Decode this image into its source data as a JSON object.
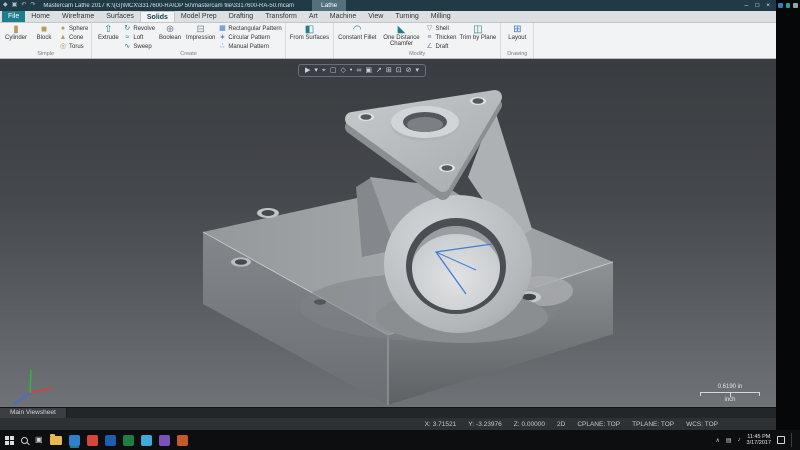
{
  "colors": {
    "accent": "#1d7f8e",
    "sketch": "#3f7fd6",
    "axis-x": "#e03c3c",
    "axis-y": "#35b53a",
    "axis-z": "#3a6fe0"
  },
  "icons": {
    "app-icon": "◆",
    "save-icon": "▣",
    "undo-icon": "↶",
    "redo-icon": "↷",
    "minimize-icon": "–",
    "maximize-icon": "□",
    "close-icon": "×",
    "cylinder-icon": "▮",
    "block-icon": "■",
    "sphere-icon": "●",
    "cone-icon": "▲",
    "torus-icon": "◎",
    "extrude-icon": "⇧",
    "revolve-icon": "↻",
    "loft-icon": "≈",
    "sweep-icon": "∿",
    "boolean-icon": "⊕",
    "impression-icon": "⊟",
    "rect-pattern-icon": "▦",
    "circ-pattern-icon": "∗",
    "manual-pattern-icon": "∴",
    "from-surfaces-icon": "◧",
    "fillet-icon": "◠",
    "chamfer-icon": "◣",
    "shell-icon": "▽",
    "thicken-icon": "≡",
    "draft-icon": "∠",
    "trim-plane-icon": "◫",
    "layout-icon": "⊞",
    "select-cursor-icon": "▶",
    "dropdown-icon": "▾",
    "crosshair-icon": "⌖",
    "window-select-icon": "▢",
    "polygon-select-icon": "◇",
    "single-select-icon": "•",
    "chain-select-icon": "∞",
    "area-select-icon": "▣",
    "vector-select-icon": "↗",
    "all-select-icon": "⊞",
    "only-select-icon": "⊡",
    "clear-select-icon": "⊘",
    "taskview-icon": "▣",
    "tray-chevron-icon": "∧",
    "tray-display-icon": "▤",
    "tray-volume-icon": "♪"
  },
  "window": {
    "title": "Mastercam Lathe 2017    K:\\(G)\\MCX\\3317600-RA\\OP 50\\mastercam file\\3317600-RA-50.mcam",
    "context_tab": "Lathe"
  },
  "ribbon": {
    "tabs": [
      "File",
      "Home",
      "Wireframe",
      "Surfaces",
      "Solids",
      "Model Prep",
      "Drafting",
      "Transform",
      "Art",
      "Machine",
      "View",
      "Turning",
      "Milling"
    ],
    "active_tab": "Solids",
    "groups": {
      "simple": {
        "label": "Simple",
        "big": [
          "Cylinder",
          "Block"
        ],
        "small": [
          "Sphere",
          "Cone",
          "Torus"
        ]
      },
      "create": {
        "label": "Create",
        "big": [
          "Extrude",
          "Boolean",
          "Impression"
        ],
        "small_a": [
          "Revolve",
          "Loft",
          "Sweep"
        ],
        "small_b": [
          "Rectangular Pattern",
          "Circular Pattern",
          "Manual Pattern"
        ]
      },
      "surfaces": {
        "label": "",
        "big": [
          "From Surfaces"
        ]
      },
      "modify": {
        "label": "Modify",
        "big": [
          "Constant Fillet",
          "One Distance Chamfer",
          "Trim by Plane"
        ],
        "small": [
          "Shell",
          "Thicken",
          "Draft"
        ]
      },
      "drawing": {
        "label": "Drawing",
        "big": [
          "Layout"
        ]
      }
    }
  },
  "viewport": {
    "scale_value": "0.6190 in",
    "scale_unit": "inch"
  },
  "viewsheet": {
    "tab": "Main Viewsheet"
  },
  "status_bar": {
    "x": "X:",
    "x_value": "3.71521",
    "y": "Y:",
    "y_value": "-3.23976",
    "z": "Z:",
    "z_value": "0.00000",
    "mode": "2D",
    "cplane": "CPLANE: TOP",
    "tplane": "TPLANE: TOP",
    "wcs": "WCS: TOP"
  },
  "taskbar": {
    "time": "11:45 PM",
    "date": "3/17/2017"
  }
}
